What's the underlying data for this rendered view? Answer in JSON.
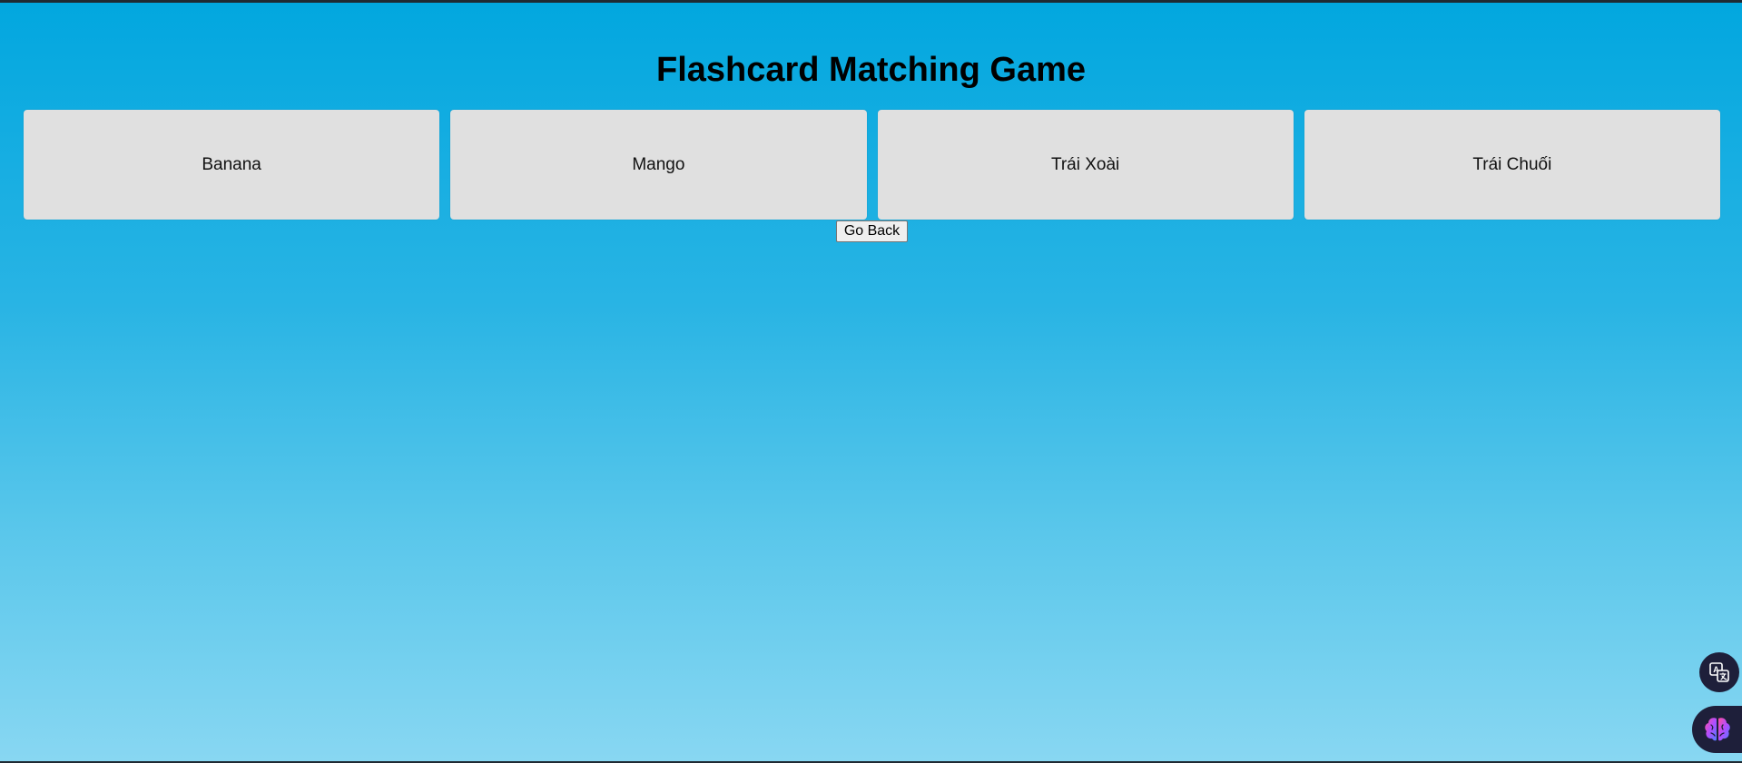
{
  "page": {
    "title": "Flashcard Matching Game"
  },
  "cards": [
    {
      "label": "Banana"
    },
    {
      "label": "Mango"
    },
    {
      "label": "Trái Xoài"
    },
    {
      "label": "Trái Chuối"
    }
  ],
  "actions": {
    "back_label": "Go Back"
  },
  "widgets": {
    "translate_icon": "translate-icon",
    "brain_icon": "brain-icon"
  },
  "colors": {
    "background_top": "#02a7df",
    "background_bottom": "#88d7f2",
    "card_bg": "#e0e0e0",
    "widget_bg": "#1e1f3a"
  }
}
